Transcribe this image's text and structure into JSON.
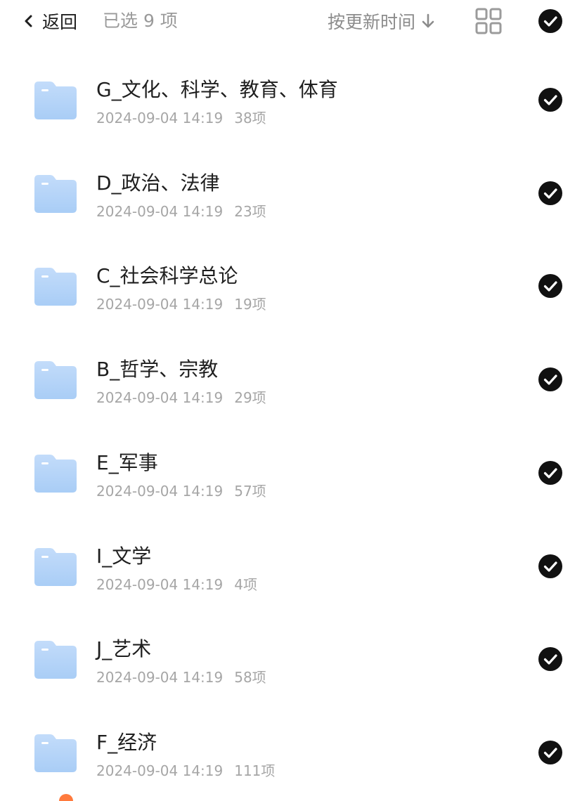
{
  "header": {
    "back_label": "返回",
    "selected_text": "已选 9 项",
    "sort_label": "按更新时间",
    "sort_arrow_icon": "arrow-down-icon",
    "view_toggle_icon": "grid-view-icon",
    "select_all_icon": "check-circle-icon"
  },
  "colors": {
    "folder": "#a9cdf6",
    "check_fill": "#111111",
    "text_primary": "#1f1f1f",
    "text_secondary": "#a6a6a6"
  },
  "items": [
    {
      "name": "G_文化、科学、教育、体育",
      "date": "2024-09-04 14:19",
      "count": "38项",
      "selected": true
    },
    {
      "name": "D_政治、法律",
      "date": "2024-09-04 14:19",
      "count": "23项",
      "selected": true
    },
    {
      "name": "C_社会科学总论",
      "date": "2024-09-04 14:19",
      "count": "19项",
      "selected": true
    },
    {
      "name": "B_哲学、宗教",
      "date": "2024-09-04 14:19",
      "count": "29项",
      "selected": true
    },
    {
      "name": "E_军事",
      "date": "2024-09-04 14:19",
      "count": "57项",
      "selected": true
    },
    {
      "name": "I_文学",
      "date": "2024-09-04 14:19",
      "count": "4项",
      "selected": true
    },
    {
      "name": "J_艺术",
      "date": "2024-09-04 14:19",
      "count": "58项",
      "selected": true
    },
    {
      "name": "F_经济",
      "date": "2024-09-04 14:19",
      "count": "111项",
      "selected": true
    }
  ]
}
